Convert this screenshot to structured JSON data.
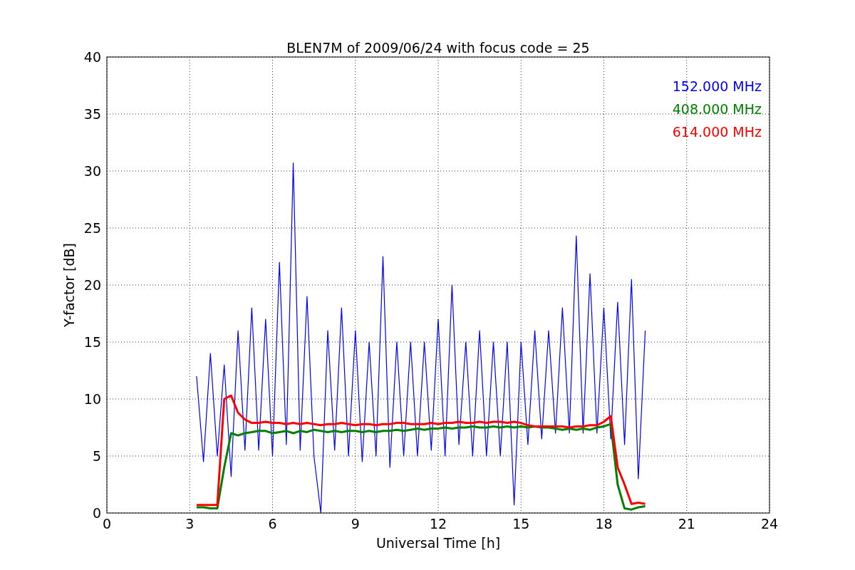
{
  "figure": {
    "chart_data": {
      "type": "line",
      "title": "BLEN7M of 2009/06/24 with focus code = 25",
      "xlabel": "Universal Time [h]",
      "ylabel": "Y-factor [dB]",
      "xlim": [
        0,
        24
      ],
      "ylim": [
        0,
        40
      ],
      "grid": true,
      "xticks": [
        0,
        3,
        6,
        9,
        12,
        15,
        18,
        21,
        24
      ],
      "yticks": [
        0,
        5,
        10,
        15,
        20,
        25,
        30,
        35,
        40
      ],
      "x": [
        3.25,
        3.5,
        3.75,
        4,
        4.25,
        4.5,
        4.75,
        5,
        5.25,
        5.5,
        5.75,
        6,
        6.25,
        6.5,
        6.75,
        7,
        7.25,
        7.5,
        7.75,
        8,
        8.25,
        8.5,
        8.75,
        9,
        9.25,
        9.5,
        9.75,
        10,
        10.25,
        10.5,
        10.75,
        11,
        11.25,
        11.5,
        11.75,
        12,
        12.25,
        12.5,
        12.75,
        13,
        13.25,
        13.5,
        13.75,
        14,
        14.25,
        14.5,
        14.75,
        15,
        15.25,
        15.5,
        15.75,
        16,
        16.25,
        16.5,
        16.75,
        17,
        17.25,
        17.5,
        17.75,
        18,
        18.25,
        18.5,
        18.75,
        19,
        19.25,
        19.5
      ],
      "series": [
        {
          "name": "152.000 MHz",
          "color": "#0000ff",
          "values": [
            12,
            4.5,
            14,
            5,
            13,
            3.2,
            16,
            5.5,
            18,
            5.5,
            17,
            5,
            22,
            6,
            30.7,
            5.5,
            19,
            5,
            0,
            16,
            5.5,
            18,
            5,
            16,
            4.5,
            15,
            5,
            22.5,
            4,
            15,
            5,
            15,
            5,
            15,
            5.5,
            17,
            5,
            20,
            6,
            15,
            5,
            16,
            5,
            15,
            5,
            15,
            0.7,
            15,
            6,
            16,
            6.5,
            16,
            7,
            18,
            7,
            24.3,
            7,
            21,
            7,
            18,
            6.5,
            18.5,
            6,
            20.5,
            3,
            16
          ]
        },
        {
          "name": "408.000 MHz",
          "color": "#008000",
          "values": [
            0.5,
            0.5,
            0.4,
            0.4,
            4,
            7,
            6.8,
            7,
            7.1,
            7.2,
            7.2,
            7,
            7.1,
            7.2,
            7,
            7.2,
            7.1,
            7.3,
            7.2,
            7.1,
            7.2,
            7.1,
            7.2,
            7.2,
            7.1,
            7.2,
            7.1,
            7.2,
            7.2,
            7.3,
            7.2,
            7.3,
            7.4,
            7.3,
            7.4,
            7.4,
            7.5,
            7.4,
            7.5,
            7.5,
            7.6,
            7.5,
            7.5,
            7.6,
            7.5,
            7.6,
            7.5,
            7.6,
            7.5,
            7.6,
            7.5,
            7.5,
            7.4,
            7.3,
            7.4,
            7.3,
            7.4,
            7.3,
            7.5,
            7.6,
            7.8,
            2.5,
            0.4,
            0.3,
            0.5,
            0.6
          ]
        },
        {
          "name": "614.000 MHz",
          "color": "#ff0000",
          "values": [
            0.7,
            0.7,
            0.7,
            0.7,
            10,
            10.3,
            8.8,
            8.2,
            7.9,
            7.9,
            8,
            7.9,
            7.9,
            7.8,
            7.9,
            7.8,
            7.9,
            7.8,
            7.7,
            7.8,
            7.8,
            7.9,
            7.8,
            7.7,
            7.8,
            7.8,
            7.7,
            7.8,
            7.8,
            7.9,
            7.9,
            7.8,
            7.8,
            7.8,
            7.9,
            7.8,
            7.9,
            7.9,
            8,
            7.9,
            7.9,
            8,
            7.9,
            8,
            8,
            7.9,
            8,
            7.9,
            7.7,
            7.6,
            7.6,
            7.6,
            7.6,
            7.6,
            7.5,
            7.6,
            7.6,
            7.7,
            7.7,
            8,
            8.5,
            4,
            2.5,
            0.8,
            0.9,
            0.8
          ]
        }
      ]
    }
  }
}
